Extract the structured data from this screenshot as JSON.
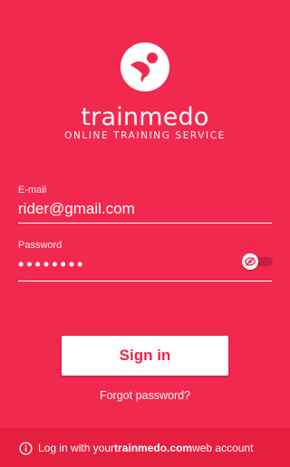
{
  "brand": {
    "name": "trainmedo",
    "tagline": "ONLINE TRAINING SERVICE"
  },
  "form": {
    "email_label": "E-mail",
    "email_value": "rider@gmail.com",
    "password_label": "Password",
    "password_value": "••••••••",
    "show_password_toggle": false
  },
  "actions": {
    "sign_in": "Sign in",
    "forgot_password": "Forgot password?"
  },
  "footer": {
    "prefix": "Log in with your ",
    "link": "trainmedo.com",
    "suffix": " web account"
  },
  "colors": {
    "background": "#f2294f",
    "accent": "#e8264b"
  },
  "icons": [
    "trainmedo-logo-icon",
    "eye-icon",
    "info-icon"
  ]
}
